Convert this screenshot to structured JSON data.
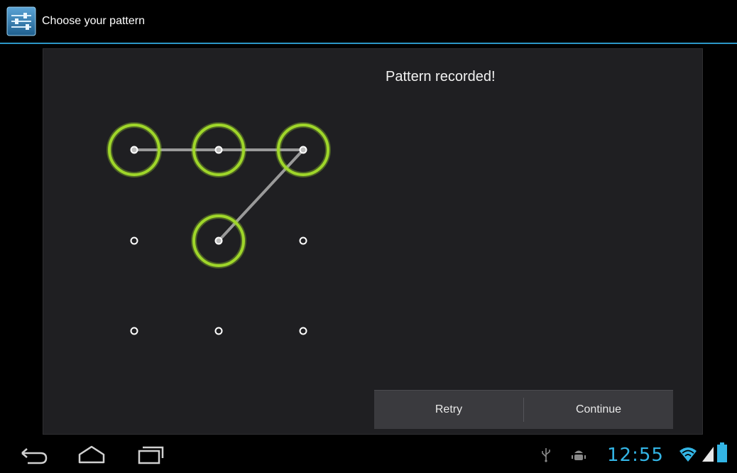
{
  "action_bar": {
    "title": "Choose your pattern",
    "app_icon": "settings-sliders-icon"
  },
  "main": {
    "status_message": "Pattern recorded!",
    "pattern": {
      "grid_size": 3,
      "selected_sequence": [
        1,
        2,
        3,
        5
      ],
      "dot_color": "#ffffff",
      "ring_color": "#9fd62a",
      "line_color": "#9a9a9a"
    }
  },
  "buttons": {
    "retry_label": "Retry",
    "continue_label": "Continue"
  },
  "system_bar": {
    "back_icon": "back-icon",
    "home_icon": "home-icon",
    "recents_icon": "recent-apps-icon",
    "clock": "12:55",
    "clock_color": "#33b5e5",
    "usb_icon": "usb-icon",
    "debug_icon": "android-debug-icon",
    "wifi_icon": "wifi-icon",
    "signal_icon": "signal-icon",
    "battery_icon": "battery-icon"
  }
}
